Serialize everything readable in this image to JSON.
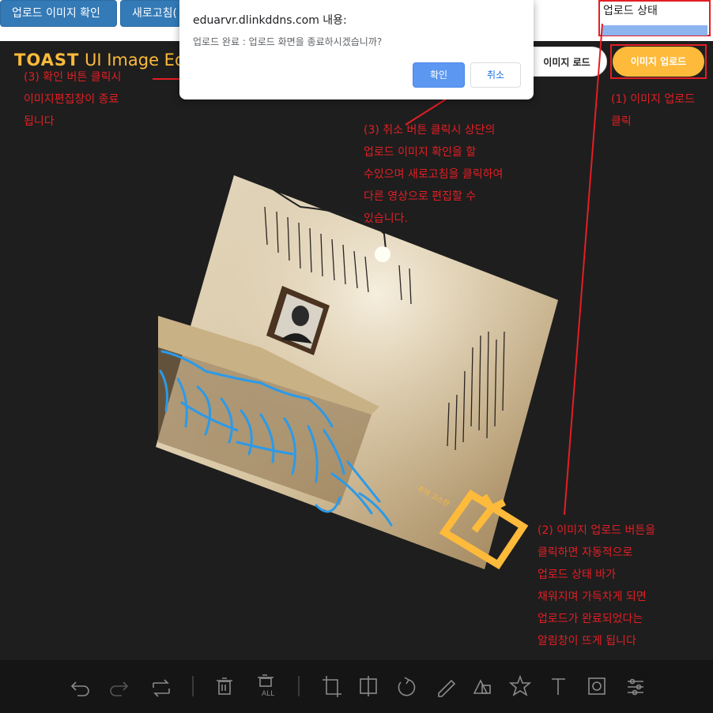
{
  "page_buttons": {
    "upload_confirm": "업로드 이미지 확인",
    "refresh": "새로고침("
  },
  "upload_status": {
    "label": "업로드 상태",
    "progress_percent": 100
  },
  "editor": {
    "logo_bold": "TOAST",
    "logo_text": " UI Image Ed",
    "load_button": "이미지 로드",
    "upload_button": "이미지 업로드",
    "image_text": "추억 고스란"
  },
  "menu_icons": [
    "undo-icon",
    "redo-icon",
    "reset-icon",
    "delete-icon",
    "delete-all-icon",
    "crop-icon",
    "flip-icon",
    "rotate-icon",
    "draw-icon",
    "shape-icon",
    "icon-icon",
    "text-icon",
    "mask-icon",
    "filter-icon"
  ],
  "dialog": {
    "title": "eduarvr.dlinkddns.com 내용:",
    "message": "업로드 완료 : 업로드 화면을 종료하시겠습니까?",
    "ok": "확인",
    "cancel": "취소"
  },
  "annotations": {
    "step1": "(1) 이미지 업로드\n클릭",
    "step2": "(2) 이미지 업로드 버튼을\n클릭하면 자동적으로\n업로드 상태 바가\n채워지며 가득차게 되면\n업로드가 완료되었다는\n알림창이 뜨게 됩니다",
    "step3_ok": "(3) 확인 버튼 클릭시\n이미지편집창이 종료\n됩니다",
    "step3_cancel": "(3) 취소 버튼 클릭시 상단의\n업로드 이미지 확인을 할\n수있으며 새로고침을 클릭하여\n다른 영상으로 편집할 수\n있습니다."
  },
  "colors": {
    "accent": "#fdba3b",
    "annotation": "#e31e24",
    "primary_button": "#337ab7",
    "progress": "#8cb4ee"
  }
}
